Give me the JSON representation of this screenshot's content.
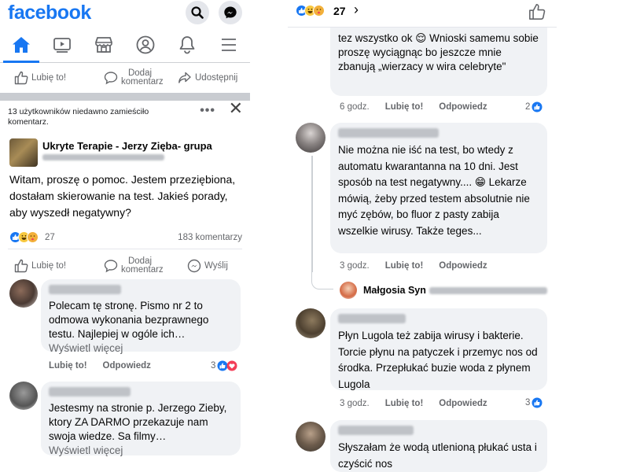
{
  "left": {
    "app_name": "facebook",
    "top_actions": {
      "like": "Lubię to!",
      "comment": "Dodaj komentarz",
      "share": "Udostępnij"
    },
    "notice": "13 użytkowników niedawno zamieściło komentarz.",
    "notice_more": "•••",
    "notice_close": "✕",
    "post": {
      "group_name": "Ukryte Terapie - Jerzy Zięba- grupa",
      "text": "Witam, proszę o pomoc. Jestem przeziębiona, dostałam skierowanie na test. Jakieś porady, aby wyszedł negatywny?",
      "reaction_count": "27",
      "comment_count": "183 komentarzy"
    },
    "post_actions": {
      "like": "Lubię to!",
      "comment": "Dodaj komentarz",
      "send": "Wyślij"
    },
    "comments": [
      {
        "text": "Polecam tę stronę. Pismo nr 2 to odmowa wykonania bezprawnego testu. Najlepiej w ogóle ich…",
        "more": "Wyświetl więcej",
        "like": "Lubię to!",
        "reply": "Odpowiedz",
        "reactions": "3"
      },
      {
        "text": "Jestesmy na stronie p. Jerzego Zieby, ktory ZA DARMO przekazuje nam swoja wiedze. Sa filmy…",
        "more": "Wyświetl więcej"
      }
    ]
  },
  "right": {
    "reaction_count": "27",
    "chevron": "›",
    "comments": [
      {
        "text": "tez wszystko ok 😌 Wnioski samemu sobie proszę wyciągnąc bo jeszcze mnie zbanują „wierzacy w wira celebryte\"",
        "time": "6 godz.",
        "like": "Lubię to!",
        "reply": "Odpowiedz",
        "reactions": "2"
      },
      {
        "text": "Nie można nie iść na test, bo wtedy z automatu kwarantanna na 10 dni. Jest sposób na test negatywny.... 😁 Lekarze mówią, żeby przed testem absolutnie nie myć zębów, bo fluor z pasty zabija wszelkie wirusy. Także teges...",
        "time": "3 godz.",
        "like": "Lubię to!",
        "reply": "Odpowiedz",
        "reply_author": "Małgosia Syn"
      },
      {
        "text": "Płyn Lugola też zabija wirusy i bakterie. Torcie płynu na patyczek i przemyc nos od środka. Przepłukać buzie woda z płynem Lugola",
        "time": "3 godz.",
        "like": "Lubię to!",
        "reply": "Odpowiedz",
        "reactions": "3"
      },
      {
        "text": "Słyszałam że wodą utlenioną płukać usta i czyścić nos"
      }
    ]
  },
  "colors": {
    "brand": "#1877f2",
    "bubble": "#f0f2f5",
    "muted": "#65676b",
    "love": "#f33e58"
  },
  "icons": [
    "search-icon",
    "messenger-icon",
    "home-icon",
    "video-icon",
    "marketplace-icon",
    "profile-icon",
    "bell-icon",
    "menu-icon",
    "thumbs-up-icon",
    "comment-icon",
    "share-icon",
    "messenger-send-icon",
    "close-icon"
  ]
}
